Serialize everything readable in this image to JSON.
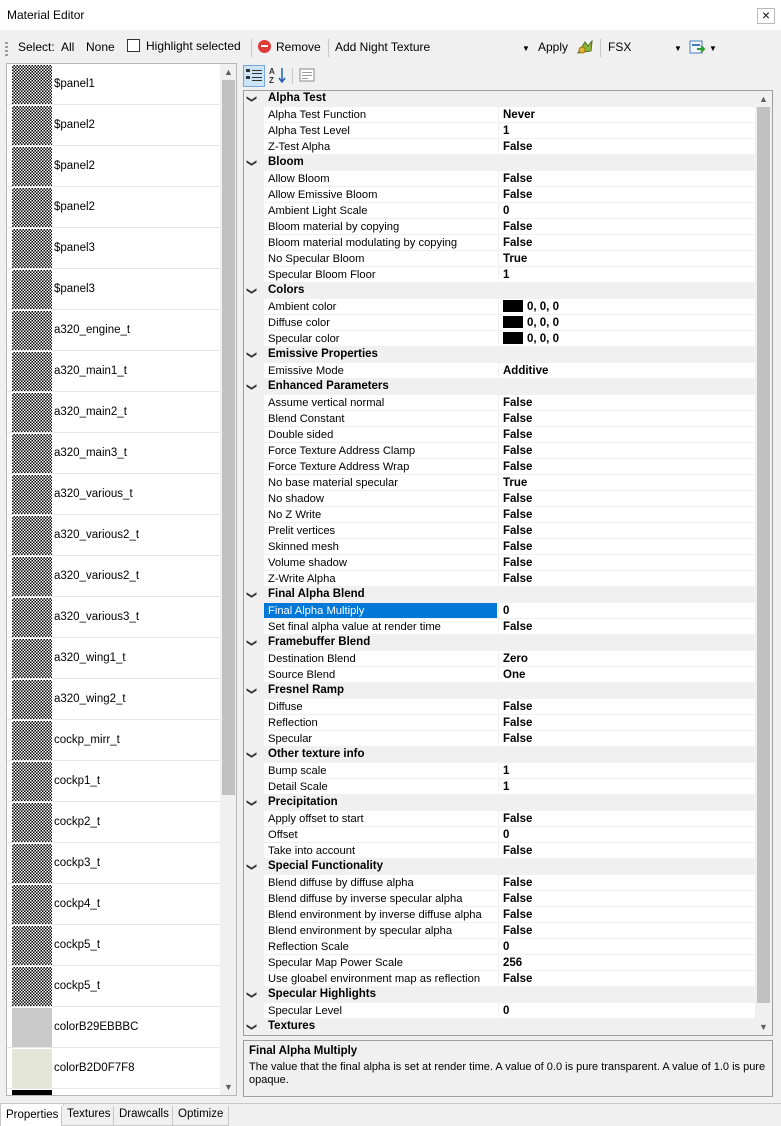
{
  "window": {
    "title": "Material Editor",
    "close_glyph": "×"
  },
  "toolbar": {
    "select_label": "Select:",
    "all_label": "All",
    "none_label": "None",
    "highlight_label": "Highlight selected",
    "remove_label": "Remove",
    "texture_combo_value": "Add Night Texture",
    "apply_label": "Apply",
    "sim_combo_value": "FSX"
  },
  "textures": [
    {
      "name": "$panel1",
      "thumb": "checker"
    },
    {
      "name": "$panel2",
      "thumb": "checker"
    },
    {
      "name": "$panel2",
      "thumb": "checker"
    },
    {
      "name": "$panel2",
      "thumb": "checker"
    },
    {
      "name": "$panel3",
      "thumb": "checker"
    },
    {
      "name": "$panel3",
      "thumb": "checker"
    },
    {
      "name": "a320_engine_t",
      "thumb": "checker"
    },
    {
      "name": "a320_main1_t",
      "thumb": "checker"
    },
    {
      "name": "a320_main2_t",
      "thumb": "checker"
    },
    {
      "name": "a320_main3_t",
      "thumb": "checker"
    },
    {
      "name": "a320_various_t",
      "thumb": "checker"
    },
    {
      "name": "a320_various2_t",
      "thumb": "checker"
    },
    {
      "name": "a320_various2_t",
      "thumb": "checker"
    },
    {
      "name": "a320_various3_t",
      "thumb": "checker"
    },
    {
      "name": "a320_wing1_t",
      "thumb": "checker"
    },
    {
      "name": "a320_wing2_t",
      "thumb": "checker"
    },
    {
      "name": "cockp_mirr_t",
      "thumb": "checker"
    },
    {
      "name": "cockp1_t",
      "thumb": "checker"
    },
    {
      "name": "cockp2_t",
      "thumb": "checker"
    },
    {
      "name": "cockp3_t",
      "thumb": "checker"
    },
    {
      "name": "cockp4_t",
      "thumb": "checker"
    },
    {
      "name": "cockp5_t",
      "thumb": "checker"
    },
    {
      "name": "cockp5_t",
      "thumb": "checker"
    },
    {
      "name": "colorB29EBBBC",
      "thumb": "#c9c9c9"
    },
    {
      "name": "colorB2D0F7F8",
      "thumb": "#e3e5d6"
    },
    {
      "name": "",
      "thumb": "#000000"
    }
  ],
  "properties": [
    {
      "category": "Alpha Test",
      "items": [
        {
          "name": "Alpha Test Function",
          "value": "Never"
        },
        {
          "name": "Alpha Test Level",
          "value": "1"
        },
        {
          "name": "Z-Test Alpha",
          "value": "False"
        }
      ]
    },
    {
      "category": "Bloom",
      "items": [
        {
          "name": "Allow Bloom",
          "value": "False"
        },
        {
          "name": "Allow Emissive Bloom",
          "value": "False"
        },
        {
          "name": "Ambient Light Scale",
          "value": "0"
        },
        {
          "name": "Bloom material by copying",
          "value": "False"
        },
        {
          "name": "Bloom material modulating by copying",
          "value": "False"
        },
        {
          "name": "No Specular Bloom",
          "value": "True"
        },
        {
          "name": "Specular Bloom Floor",
          "value": "1"
        }
      ]
    },
    {
      "category": "Colors",
      "items": [
        {
          "name": "Ambient color",
          "value": "0, 0, 0",
          "swatch": "#000000"
        },
        {
          "name": "Diffuse color",
          "value": "0, 0, 0",
          "swatch": "#000000"
        },
        {
          "name": "Specular color",
          "value": "0, 0, 0",
          "swatch": "#000000"
        }
      ]
    },
    {
      "category": "Emissive Properties",
      "items": [
        {
          "name": "Emissive Mode",
          "value": "Additive"
        }
      ]
    },
    {
      "category": "Enhanced Parameters",
      "items": [
        {
          "name": "Assume vertical normal",
          "value": "False"
        },
        {
          "name": "Blend Constant",
          "value": "False"
        },
        {
          "name": "Double sided",
          "value": "False"
        },
        {
          "name": "Force Texture Address Clamp",
          "value": "False"
        },
        {
          "name": "Force Texture Address Wrap",
          "value": "False"
        },
        {
          "name": "No base material specular",
          "value": "True"
        },
        {
          "name": "No shadow",
          "value": "False"
        },
        {
          "name": "No Z Write",
          "value": "False"
        },
        {
          "name": "Prelit vertices",
          "value": "False"
        },
        {
          "name": "Skinned mesh",
          "value": "False"
        },
        {
          "name": "Volume shadow",
          "value": "False"
        },
        {
          "name": "Z-Write Alpha",
          "value": "False"
        }
      ]
    },
    {
      "category": "Final Alpha Blend",
      "items": [
        {
          "name": "Final Alpha Multiply",
          "value": "0",
          "selected": true
        },
        {
          "name": "Set final alpha value at render time",
          "value": "False"
        }
      ]
    },
    {
      "category": "Framebuffer Blend",
      "items": [
        {
          "name": "Destination Blend",
          "value": "Zero"
        },
        {
          "name": "Source Blend",
          "value": "One"
        }
      ]
    },
    {
      "category": "Fresnel Ramp",
      "items": [
        {
          "name": "Diffuse",
          "value": "False"
        },
        {
          "name": "Reflection",
          "value": "False"
        },
        {
          "name": "Specular",
          "value": "False"
        }
      ]
    },
    {
      "category": "Other texture info",
      "items": [
        {
          "name": "Bump scale",
          "value": "1"
        },
        {
          "name": "Detail Scale",
          "value": "1"
        }
      ]
    },
    {
      "category": "Precipitation",
      "items": [
        {
          "name": "Apply offset to start",
          "value": "False"
        },
        {
          "name": "Offset",
          "value": "0"
        },
        {
          "name": "Take into account",
          "value": "False"
        }
      ]
    },
    {
      "category": "Special Functionality",
      "items": [
        {
          "name": "Blend diffuse by diffuse alpha",
          "value": "False"
        },
        {
          "name": "Blend diffuse by inverse specular alpha",
          "value": "False"
        },
        {
          "name": "Blend environment by inverse diffuse alpha",
          "value": "False"
        },
        {
          "name": "Blend environment by specular alpha",
          "value": "False"
        },
        {
          "name": "Reflection Scale",
          "value": "0"
        },
        {
          "name": "Specular Map Power Scale",
          "value": "256"
        },
        {
          "name": "Use gloabel environment map as reflection",
          "value": "False"
        }
      ]
    },
    {
      "category": "Specular Highlights",
      "items": [
        {
          "name": "Specular Level",
          "value": "0"
        }
      ]
    },
    {
      "category": "Textures",
      "items": []
    }
  ],
  "description": {
    "title": "Final Alpha Multiply",
    "text": "The value that the final alpha is set at render time. A value of 0.0 is pure transparent. A value of 1.0 is pure opaque."
  },
  "tabs": [
    {
      "label": "Properties",
      "active": true
    },
    {
      "label": "Textures",
      "active": false
    },
    {
      "label": "Drawcalls",
      "active": false
    },
    {
      "label": "Optimize",
      "active": false
    }
  ],
  "icons": {
    "categorized": "categorized-view-icon",
    "alphabetical": "alphabetical-sort-icon",
    "property_pages": "property-pages-icon"
  }
}
